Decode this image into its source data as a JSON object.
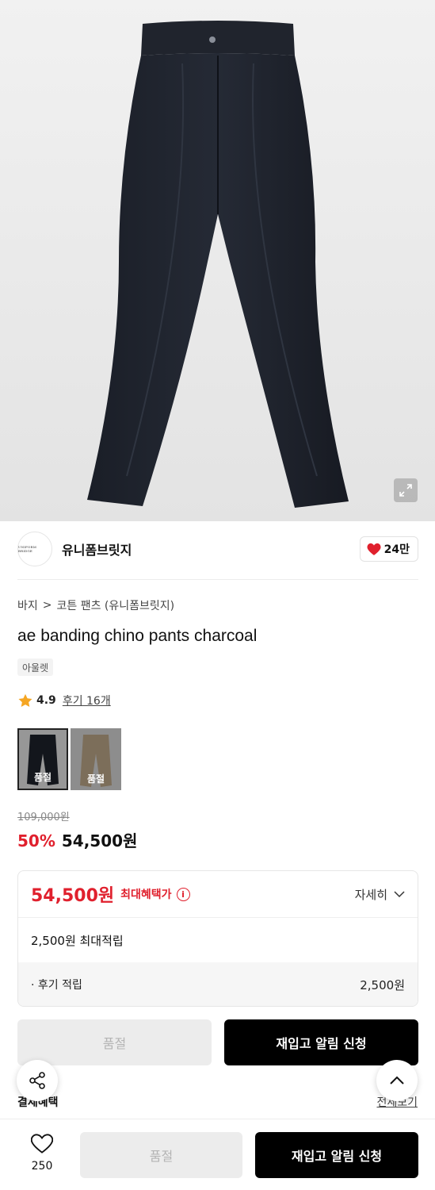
{
  "product_image": {
    "alt_icon": "expand-icon"
  },
  "brand": {
    "name": "유니폼브릿지",
    "logo_text": "UNIFORM BRIDGE",
    "likes": "24만"
  },
  "breadcrumb": {
    "category": "바지",
    "separator": ">",
    "subcategory": "코튼 팬츠 (유니폼브릿지)"
  },
  "product": {
    "title": "ae banding chino pants charcoal",
    "badge": "아울렛",
    "rating": "4.9",
    "review_link": "후기 16개"
  },
  "swatches": [
    {
      "label": "품절",
      "color": "#1e222b",
      "selected": true
    },
    {
      "label": "품절",
      "color": "#bfa98a",
      "selected": false
    }
  ],
  "pricing": {
    "original": "109,000원",
    "discount": "50%",
    "sale": "54,500원"
  },
  "benefits": {
    "price": "54,500원",
    "max_benefit_label": "최대혜택가",
    "detail_label": "자세히",
    "points_label": "2,500원 최대적립",
    "review_points_label": "· 후기 적립",
    "review_points_amount": "2,500원"
  },
  "actions": {
    "soldout_label": "품절",
    "restock_label": "재입고 알림 신청"
  },
  "payment": {
    "label": "결제혜택",
    "view_all": "전체보기"
  },
  "bottom_bar": {
    "like_count": "250",
    "soldout_label": "품절",
    "restock_label": "재입고 알림 신청"
  },
  "colors": {
    "accent_red": "#e0202d",
    "primary_black": "#000000",
    "disabled_gray": "#ececec"
  }
}
